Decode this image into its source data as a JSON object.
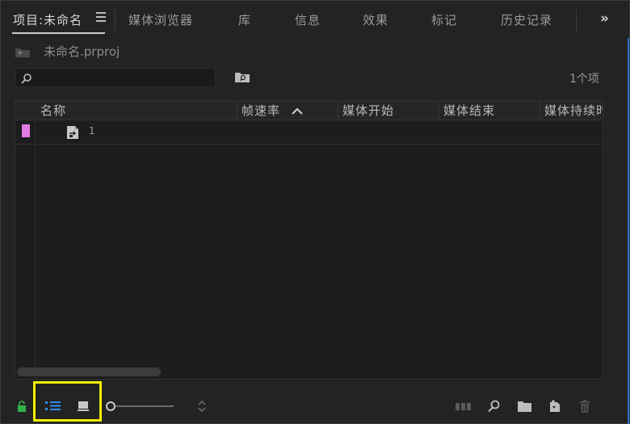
{
  "tabs": [
    {
      "label": "项目:未命名",
      "active": true
    },
    {
      "label": "媒体浏览器"
    },
    {
      "label": "库"
    },
    {
      "label": "信息"
    },
    {
      "label": "效果"
    },
    {
      "label": "标记"
    },
    {
      "label": "历史记录"
    }
  ],
  "overflow": "»",
  "breadcrumb": "未命名.prproj",
  "search": {
    "placeholder": "",
    "value": ""
  },
  "item_count": "1个项",
  "columns": [
    "名称",
    "帧速率",
    "媒体开始",
    "媒体结束",
    "媒体持续时"
  ],
  "rows": [
    {
      "name": "1",
      "label_color": "#e27be3",
      "icon": "sequence-icon"
    }
  ],
  "accent": "#2d6ec9",
  "highlight_color": "#f4f000"
}
